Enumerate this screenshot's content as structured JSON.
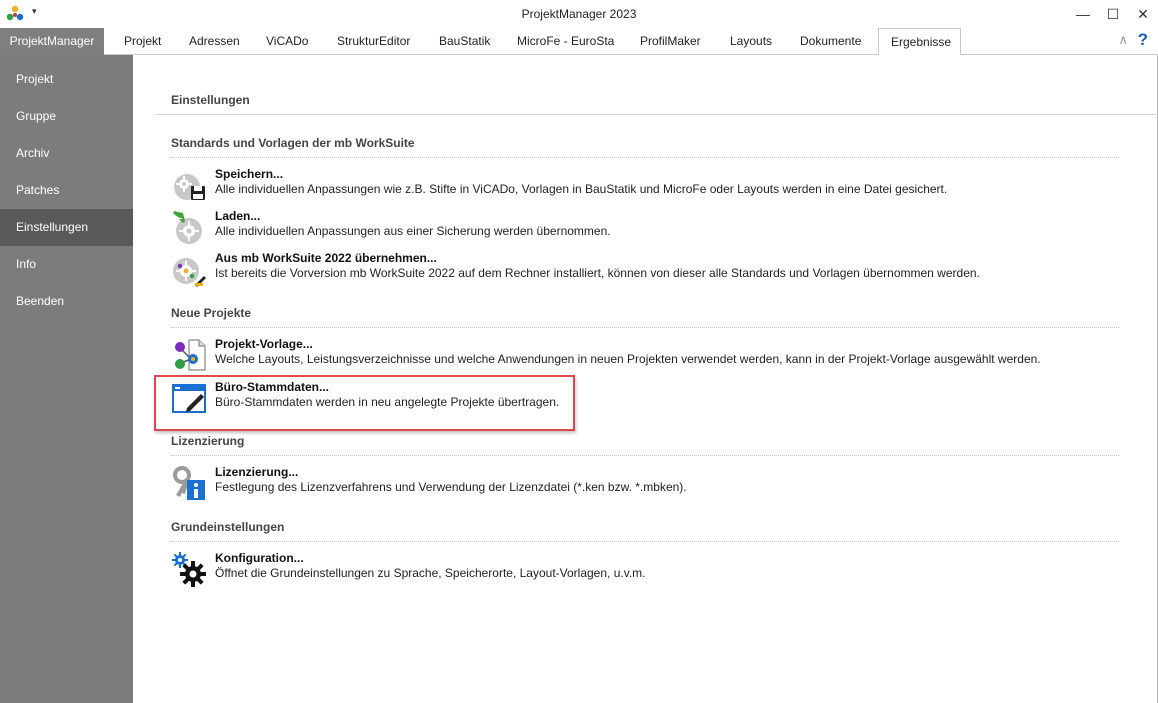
{
  "window": {
    "title": "ProjektManager 2023",
    "minimize_glyph": "—",
    "maximize_glyph": "☐",
    "close_glyph": "✕",
    "quick_access_glyph": "▾"
  },
  "ribbon": {
    "app_tab": "ProjektManager",
    "tabs": [
      "Projekt",
      "Adressen",
      "ViCADo",
      "StrukturEditor",
      "BauStatik",
      "MicroFe - EuroSta",
      "ProfilMaker",
      "Layouts",
      "Dokumente",
      "Ergebnisse"
    ],
    "active_tab": "Ergebnisse",
    "collapse_glyph": "∧",
    "help_glyph": "?"
  },
  "sidebar": {
    "items": [
      "Projekt",
      "Gruppe",
      "Archiv",
      "Patches",
      "Einstellungen",
      "Info",
      "Beenden"
    ],
    "active": "Einstellungen"
  },
  "content": {
    "title": "Einstellungen",
    "sections": [
      {
        "title": "Standards und Vorlagen der mb WorkSuite",
        "entries": [
          {
            "title": "Speichern...",
            "desc": "Alle individuellen Anpassungen wie z.B. Stifte in ViCADo, Vorlagen in BauStatik und MicroFe oder Layouts werden in eine Datei gesichert.",
            "icon": "gear-save-icon"
          },
          {
            "title": "Laden...",
            "desc": "Alle individuellen Anpassungen aus einer Sicherung werden übernommen.",
            "icon": "gear-load-icon"
          },
          {
            "title": "Aus mb WorkSuite 2022 übernehmen...",
            "desc": "Ist bereits die Vorversion mb WorkSuite 2022 auf dem Rechner installiert, können von dieser alle Standards und Vorlagen übernommen werden.",
            "icon": "gear-import-icon"
          }
        ]
      },
      {
        "title": "Neue Projekte",
        "entries": [
          {
            "title": "Projekt-Vorlage...",
            "desc": "Welche Layouts, Leistungsverzeichnisse und welche Anwendungen in neuen Projekten verwendet werden, kann in der Projekt-Vorlage ausgewählt werden.",
            "icon": "project-template-icon"
          },
          {
            "title": "Büro-Stammdaten...",
            "desc": "Büro-Stammdaten werden in neu angelegte Projekte übertragen.",
            "icon": "office-data-icon"
          }
        ]
      },
      {
        "title": "Lizenzierung",
        "entries": [
          {
            "title": "Lizenzierung...",
            "desc": "Festlegung des Lizenzverfahrens und Verwendung der Lizenzdatei (*.ken bzw. *.mbken).",
            "icon": "license-key-icon"
          }
        ]
      },
      {
        "title": "Grundeinstellungen",
        "entries": [
          {
            "title": "Konfiguration...",
            "desc": "Öffnet die Grundeinstellungen zu Sprache, Speicherorte, Layout-Vorlagen, u.v.m.",
            "icon": "configuration-gears-icon"
          }
        ]
      }
    ]
  },
  "colors": {
    "sidebar_bg": "#7c7c7c",
    "sidebar_active": "#595959",
    "highlight": "#e0474c",
    "accent_blue": "#1a5fb4"
  }
}
